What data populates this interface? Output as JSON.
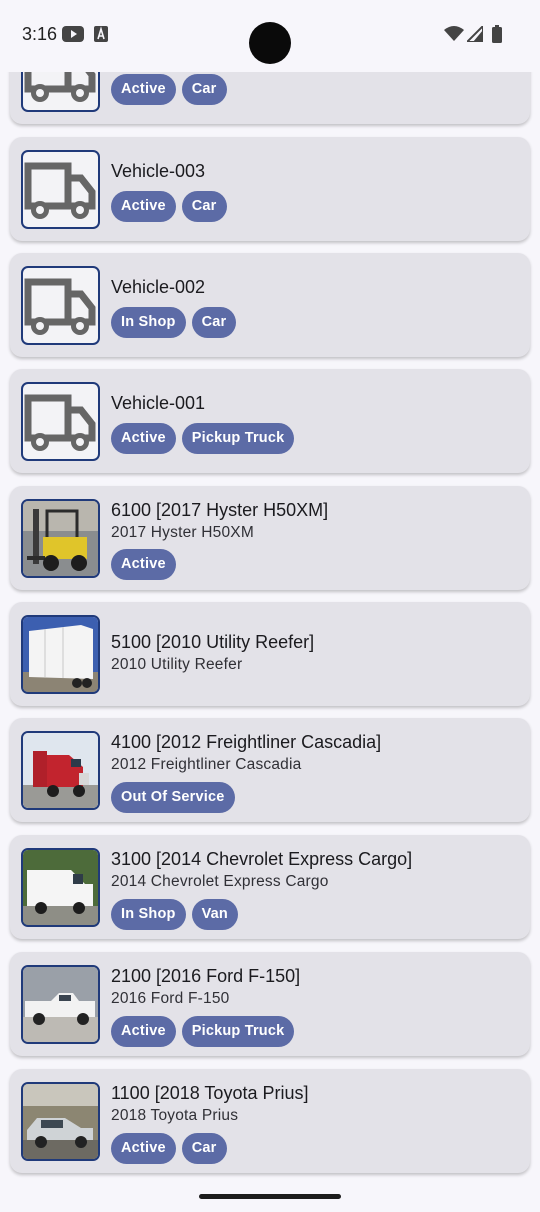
{
  "status_bar": {
    "time": "3:16",
    "icons": [
      "youtube-icon",
      "a-notification-icon",
      "wifi-icon",
      "cell-signal-icon",
      "battery-icon"
    ]
  },
  "colors": {
    "card_bg": "#e3e2e8",
    "chip_bg": "#5c6ba6",
    "thumb_border": "#203a7a",
    "truck_icon": "#666666"
  },
  "vehicles": [
    {
      "title": "",
      "subtitle": "",
      "thumb": "truck-placeholder-icon",
      "chips": [
        "Active",
        "Car"
      ]
    },
    {
      "title": "Vehicle-003",
      "subtitle": "",
      "thumb": "truck-placeholder-icon",
      "chips": [
        "Active",
        "Car"
      ]
    },
    {
      "title": "Vehicle-002",
      "subtitle": "",
      "thumb": "truck-placeholder-icon",
      "chips": [
        "In Shop",
        "Car"
      ]
    },
    {
      "title": "Vehicle-001",
      "subtitle": "",
      "thumb": "truck-placeholder-icon",
      "chips": [
        "Active",
        "Pickup Truck"
      ]
    },
    {
      "title": "6100 [2017 Hyster H50XM]",
      "subtitle": "2017 Hyster H50XM",
      "thumb": "forklift-photo",
      "chips": [
        "Active"
      ]
    },
    {
      "title": "5100 [2010 Utility Reefer]",
      "subtitle": "2010 Utility Reefer",
      "thumb": "reefer-trailer-photo",
      "chips": []
    },
    {
      "title": "4100 [2012 Freightliner Cascadia]",
      "subtitle": "2012 Freightliner Cascadia",
      "thumb": "semi-truck-photo",
      "chips": [
        "Out Of Service"
      ]
    },
    {
      "title": "3100 [2014 Chevrolet Express Cargo]",
      "subtitle": "2014 Chevrolet Express Cargo",
      "thumb": "cargo-van-photo",
      "chips": [
        "In Shop",
        "Van"
      ]
    },
    {
      "title": "2100 [2016 Ford F-150]",
      "subtitle": "2016 Ford F-150",
      "thumb": "pickup-truck-photo",
      "chips": [
        "Active",
        "Pickup Truck"
      ]
    },
    {
      "title": "1100 [2018 Toyota Prius]",
      "subtitle": "2018 Toyota Prius",
      "thumb": "sedan-car-photo",
      "chips": [
        "Active",
        "Car"
      ]
    }
  ]
}
